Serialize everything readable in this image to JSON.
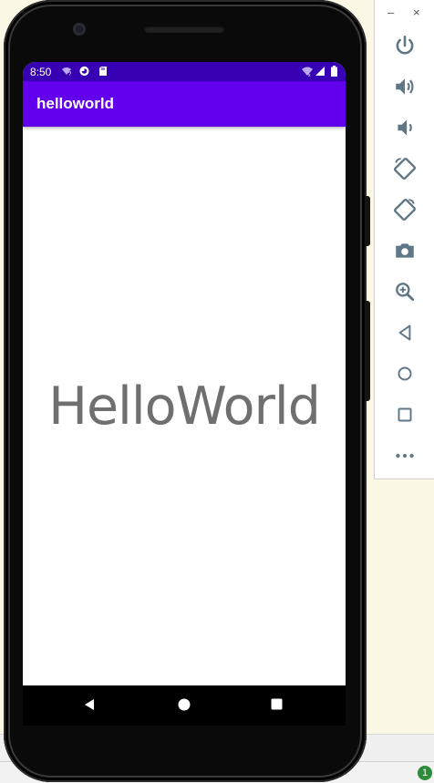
{
  "status_bar": {
    "time": "8:50"
  },
  "app": {
    "title": "helloworld",
    "hello_text": "HelloWorld"
  },
  "toolbar": {
    "minimize_label": "–",
    "close_label": "×",
    "buttons": [
      "power-icon",
      "volume-up-icon",
      "volume-down-icon",
      "rotate-left-icon",
      "rotate-right-icon",
      "camera-icon",
      "zoom-icon",
      "back-icon",
      "home-icon",
      "overview-icon",
      "more-icon"
    ]
  },
  "host": {
    "notification_count": "1"
  },
  "colors": {
    "status_bar": "#3700b3",
    "app_bar": "#6200ee",
    "toolbar_icon": "#5f7786",
    "hello_text": "#6f6f6f"
  }
}
